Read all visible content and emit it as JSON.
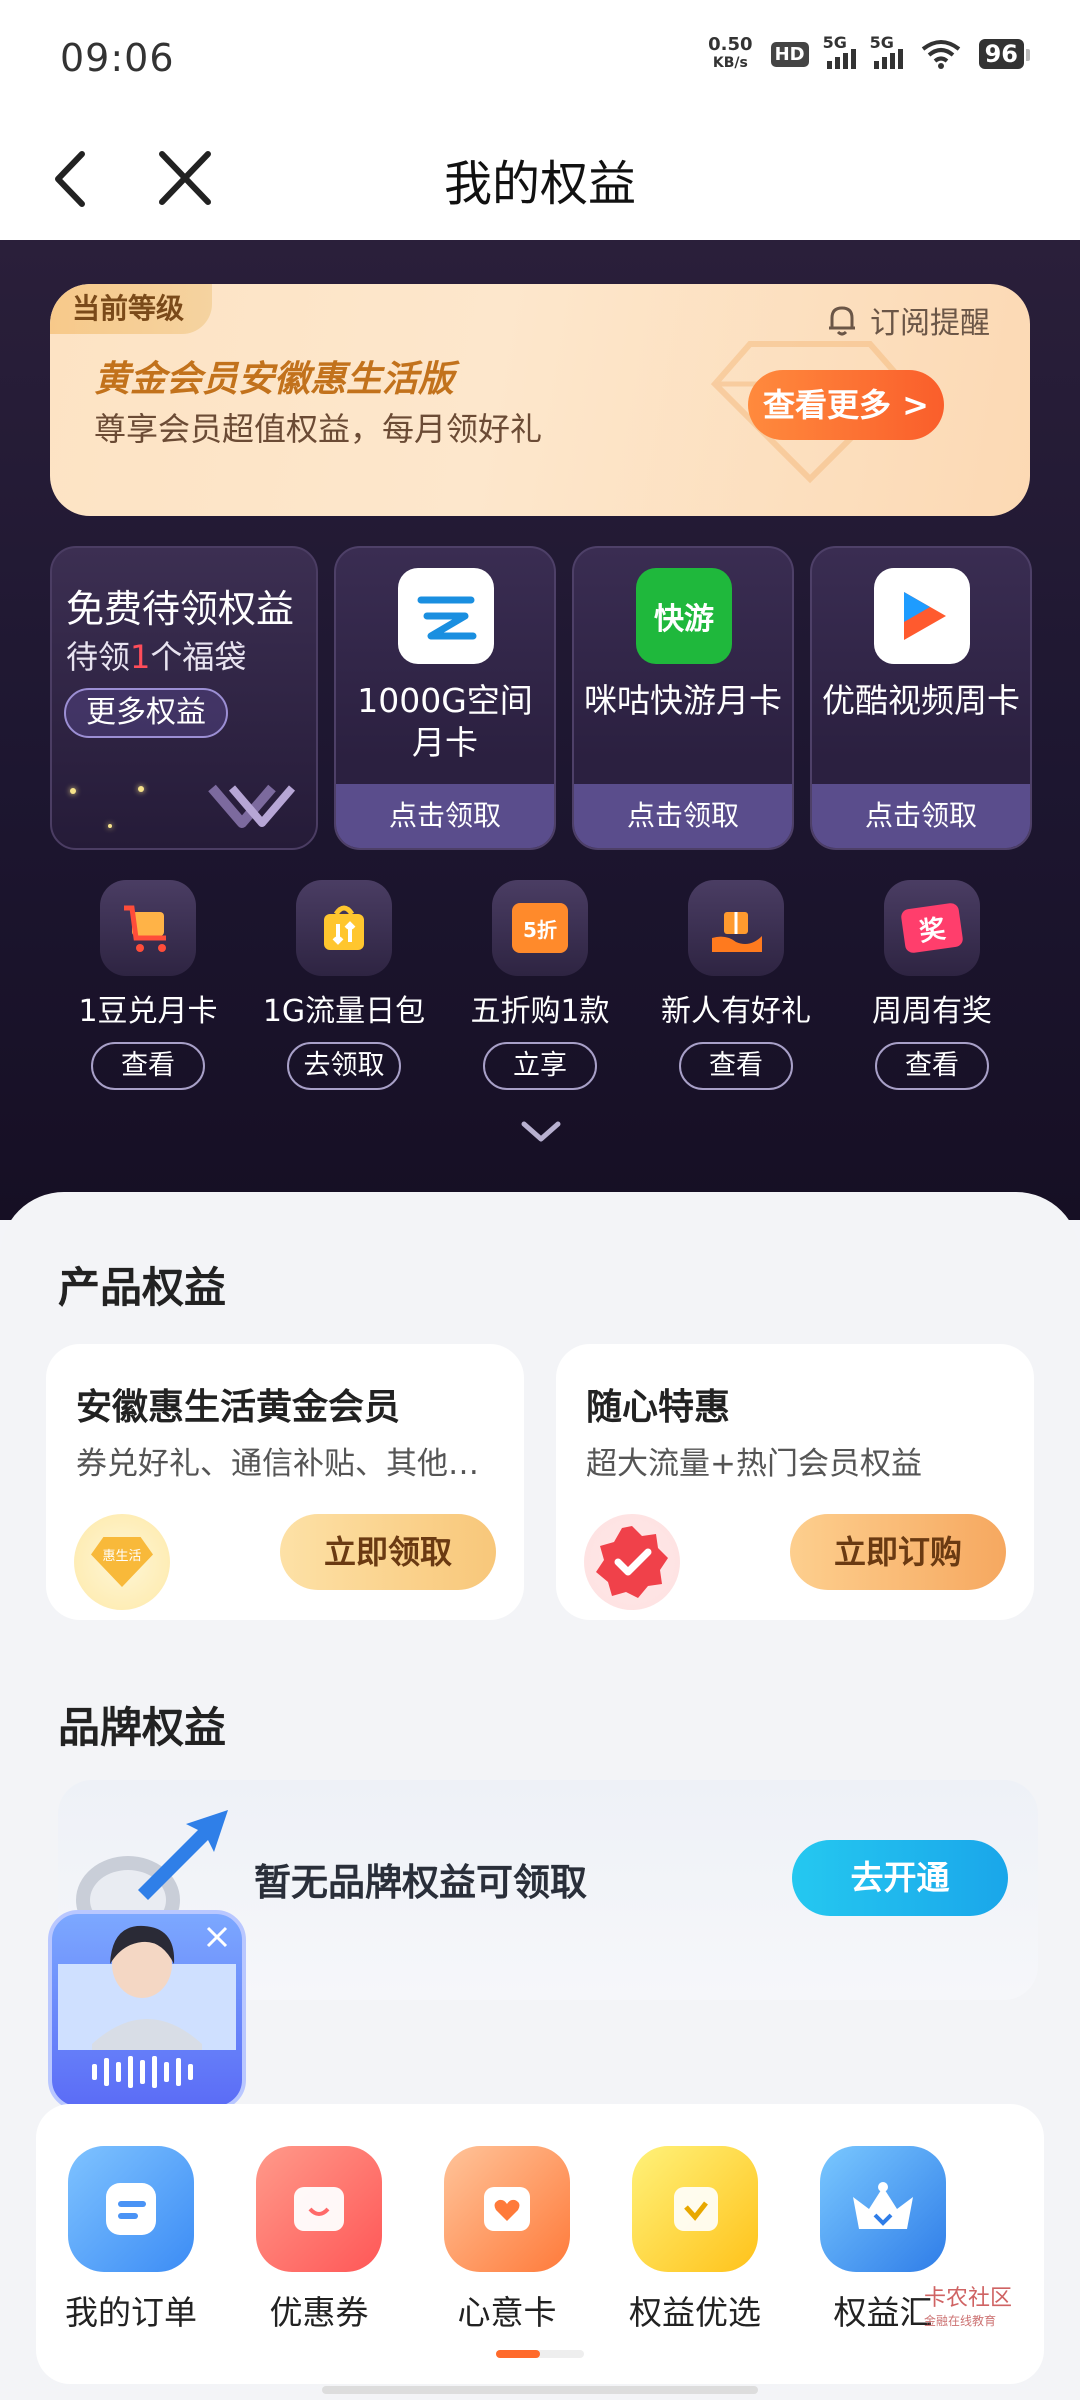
{
  "status": {
    "time": "09:06",
    "net_speed_value": "0.50",
    "net_speed_unit": "KB/s",
    "hd": "HD",
    "sim1": "5G",
    "sim2": "5G",
    "battery": "96"
  },
  "nav": {
    "title": "我的权益"
  },
  "level": {
    "tag": "当前等级",
    "subscribe": "订阅提醒",
    "title": "黄金会员安徽惠生活版",
    "subtitle": "尊享会员超值权益，每月领好礼",
    "more_button": "查看更多 >"
  },
  "free": {
    "title": "免费待领权益",
    "sub_prefix": "待领",
    "sub_count": "1",
    "sub_suffix": "个福袋",
    "more_button": "更多权益"
  },
  "app_cards": [
    {
      "name": "1000G空间月卡",
      "claim": "点击领取",
      "icon": "cloud-icon"
    },
    {
      "name": "咪咕快游月卡",
      "claim": "点击领取",
      "icon": "migu-kuaiyou-icon",
      "icon_text": "快游"
    },
    {
      "name": "优酷视频周卡",
      "claim": "点击领取",
      "icon": "youku-icon"
    }
  ],
  "quick": [
    {
      "label": "1豆兑月卡",
      "button": "查看",
      "icon": "cart-icon"
    },
    {
      "label": "1G流量日包",
      "button": "去领取",
      "icon": "data-bag-icon"
    },
    {
      "label": "五折购1款",
      "button": "立享",
      "icon": "discount-ticket-icon",
      "icon_text": "5折"
    },
    {
      "label": "新人有好礼",
      "button": "查看",
      "icon": "gift-hand-icon"
    },
    {
      "label": "周周有奖",
      "button": "查看",
      "icon": "prize-ticket-icon",
      "icon_text": "奖"
    }
  ],
  "product": {
    "section_title": "产品权益",
    "cards": [
      {
        "name": "安徽惠生活黄金会员",
        "desc": "券兑好礼、通信补贴、其他专属权益",
        "button": "立即领取",
        "badge_text": "惠生活"
      },
      {
        "name": "随心特惠",
        "desc": "超大流量+热门会员权益",
        "button": "立即订购"
      }
    ]
  },
  "brand": {
    "section_title": "品牌权益",
    "empty_text": "暂无品牌权益可领取",
    "button": "去开通"
  },
  "bottom_nav": [
    {
      "label": "我的订单",
      "icon": "order-icon"
    },
    {
      "label": "优惠券",
      "icon": "coupon-icon"
    },
    {
      "label": "心意卡",
      "icon": "heart-card-icon"
    },
    {
      "label": "权益优选",
      "icon": "select-icon"
    },
    {
      "label": "权益汇",
      "icon": "crown-icon"
    }
  ],
  "watermark": {
    "text": "卡农社区",
    "sub": "金融在线教育"
  },
  "colors": {
    "hero_bg": "#1d1630",
    "accent_orange": "#fa5e2b",
    "gold_text": "#c2721c",
    "claim_bar": "#5a4d8c",
    "brand_button": "#1aa6ea"
  }
}
